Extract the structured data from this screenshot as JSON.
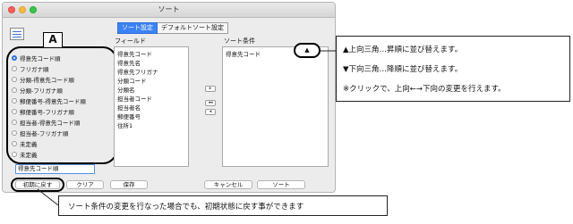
{
  "window": {
    "title": "ソート"
  },
  "tabs": [
    {
      "label": "ソート設定",
      "active": true
    },
    {
      "label": "デフォルトソート設定",
      "active": false
    }
  ],
  "badge_label": "A",
  "radio_options": [
    {
      "label": "得意先コード順",
      "checked": true
    },
    {
      "label": "フリガナ順",
      "checked": false
    },
    {
      "label": "分類-得意先コード順",
      "checked": false
    },
    {
      "label": "分類-フリガナ順",
      "checked": false
    },
    {
      "label": "郵便番号-得意先コード順",
      "checked": false
    },
    {
      "label": "郵便番号-フリガナ順",
      "checked": false
    },
    {
      "label": "担当者-得意先コード順",
      "checked": false
    },
    {
      "label": "担当者-フリガナ順",
      "checked": false
    },
    {
      "label": "未定義",
      "checked": false
    },
    {
      "label": "未定義",
      "checked": false
    }
  ],
  "selected_sort_name": "得意先コード順",
  "field_list": {
    "label": "フィールド",
    "items": [
      "得意先コード",
      "得意先名",
      "得意先フリガナ",
      "分類コード",
      "分類名",
      "担当者コード",
      "担当者名",
      "郵便番号",
      "住所1"
    ]
  },
  "condition_list": {
    "label": "ソート条件",
    "items": [
      "得意先コード"
    ]
  },
  "arrow_buttons": {
    "add": "▸",
    "remove_all": "◂◂",
    "remove": "◂"
  },
  "sort_direction_glyph": "▲",
  "buttons": {
    "reset": "初期に戻す",
    "clear": "クリア",
    "save": "保存",
    "cancel": "キャンセル",
    "sort": "ソート"
  },
  "annotations": {
    "right_lines": [
      "▲上向三角…昇順に並び替えます。",
      "▼下向三角…降順に並び替えます。",
      "※クリックで、上向←→下向の変更を行えます。"
    ],
    "bottom": "ソート条件の変更を行なった場合でも、初期状態に戻す事ができます"
  },
  "colors": {
    "accent": "#2f6fd8",
    "outline": "#000000"
  }
}
